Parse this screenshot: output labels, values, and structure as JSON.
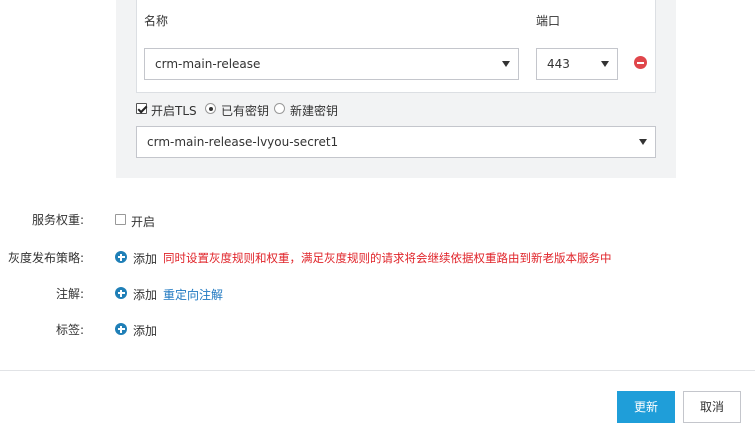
{
  "rule": {
    "name_header": "名称",
    "port_header": "端口",
    "service_name": "crm-main-release",
    "service_port": "443",
    "tls_label": "开启TLS",
    "tls_enabled": true,
    "existing_secret_label": "已有密钥",
    "new_secret_label": "新建密钥",
    "secret_mode": "existing",
    "secret_value": "crm-main-release-lvyou-secret1"
  },
  "form": {
    "weight_label": "服务权重:",
    "weight_option": "开启",
    "weight_enabled": false,
    "canary_label": "灰度发布策略:",
    "canary_add": "添加",
    "canary_hint": "同时设置灰度规则和权重，满足灰度规则的请求将会继续依据权重路由到新老版本服务中",
    "annotation_label": "注解:",
    "annotation_add": "添加",
    "annotation_link": "重定向注解",
    "tag_label": "标签:",
    "tag_add": "添加"
  },
  "footer": {
    "update_label": "更新",
    "cancel_label": "取消"
  },
  "colors": {
    "primary": "#1f9ed9",
    "danger": "#e0464b",
    "hint_red": "#e0242a",
    "link_blue": "#1f78c1"
  }
}
